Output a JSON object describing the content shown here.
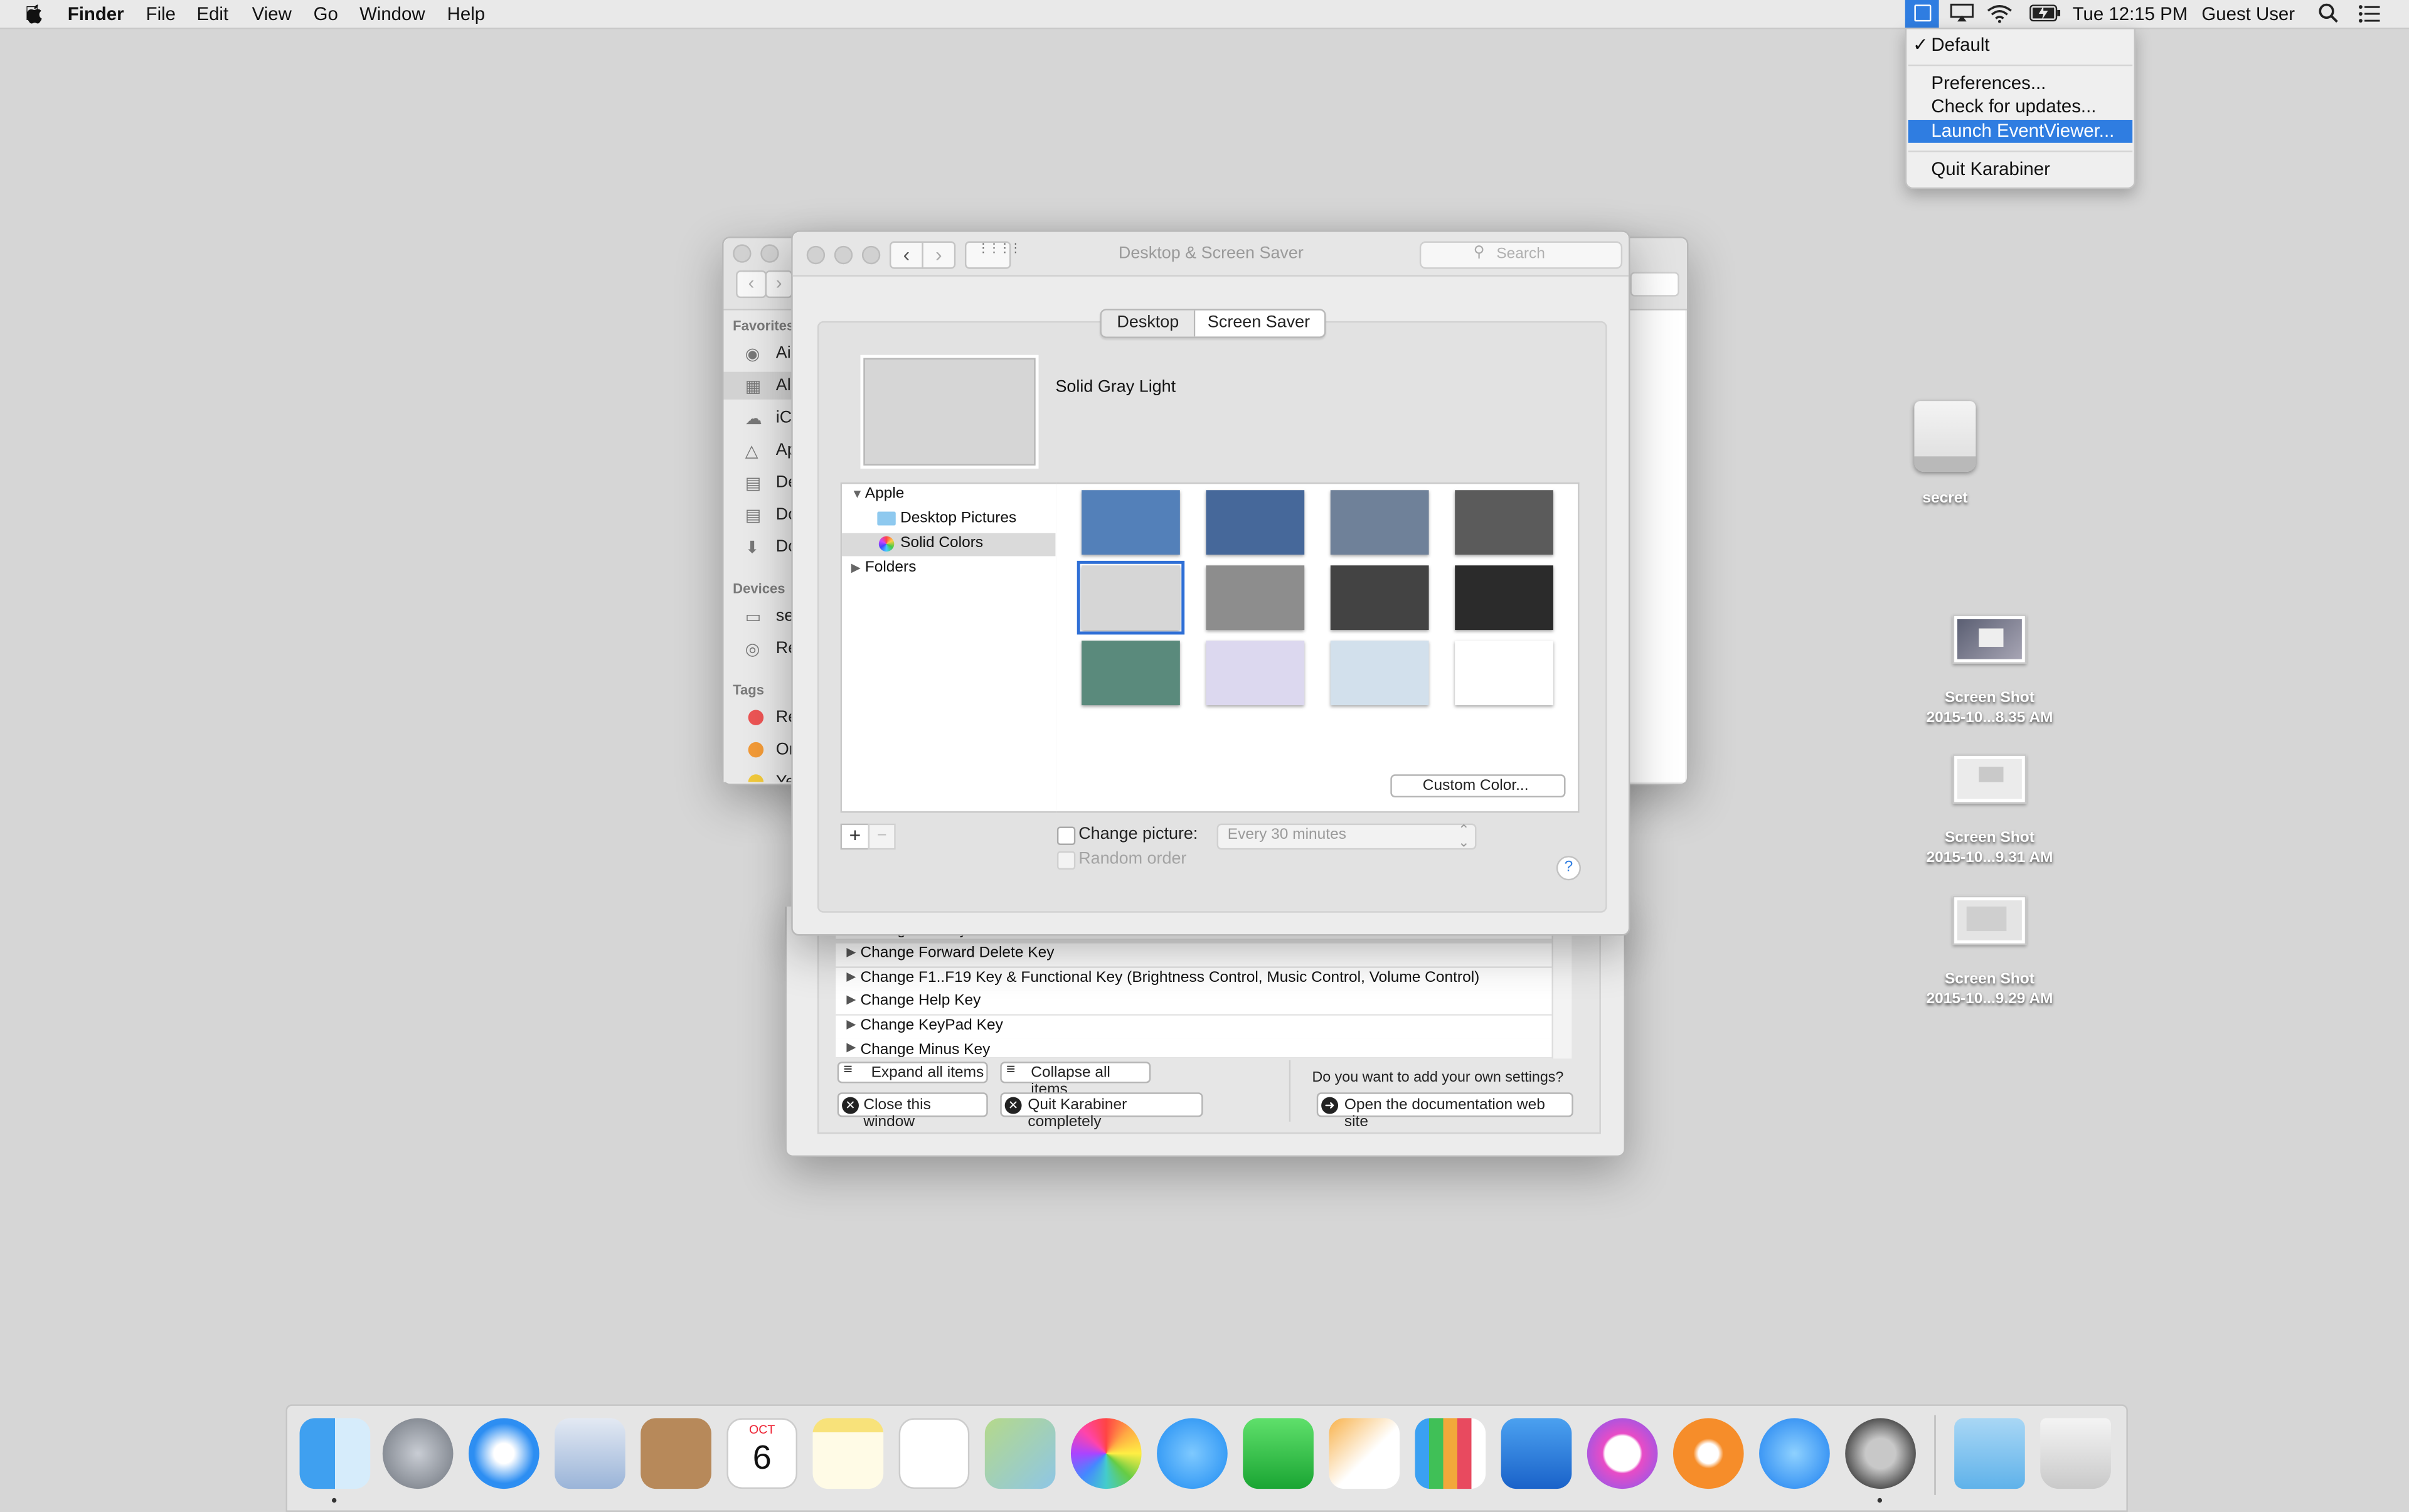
{
  "menubar": {
    "apple": "",
    "app": "Finder",
    "items": [
      "File",
      "Edit",
      "View",
      "Go",
      "Window",
      "Help"
    ],
    "clock": "Tue 12:15 PM",
    "user": "Guest User"
  },
  "karabiner_menu": {
    "checked": "✓",
    "default": "Default",
    "preferences": "Preferences...",
    "check_updates": "Check for updates...",
    "launch_eventviewer": "Launch EventViewer...",
    "quit": "Quit Karabiner",
    "highlight": "#2f7de1"
  },
  "finder": {
    "favorites_header": "Favorites",
    "favorites": [
      "Ai",
      "Al",
      "iC",
      "Ap",
      "De",
      "Do",
      "Do"
    ],
    "devices_header": "Devices",
    "devices": [
      "se",
      "Re"
    ],
    "tags_header": "Tags",
    "tags": [
      {
        "label": "Re",
        "color": "#ec5454"
      },
      {
        "label": "Or",
        "color": "#f29a37"
      },
      {
        "label": "Ye",
        "color": "#f1c93b"
      }
    ]
  },
  "screensaver": {
    "title": "Desktop & Screen Saver",
    "search_placeholder": "Search",
    "tabs": [
      "Desktop",
      "Screen Saver"
    ],
    "preview_label": "Solid Gray Light",
    "tree": {
      "apple": "Apple",
      "desktop_pictures": "Desktop Pictures",
      "solid_colors": "Solid Colors",
      "folders": "Folders"
    },
    "swatches": [
      "#5380b9",
      "#46689a",
      "#6f8199",
      "#5b5b5b",
      "#d6d6d6",
      "#8d8d8d",
      "#434343",
      "#2b2b2b",
      "#5a8a7c",
      "#dcd8ef",
      "#d2e0ec",
      "#ffffff"
    ],
    "selected_swatch": 4,
    "custom_color": "Custom Color...",
    "add": "+",
    "remove": "−",
    "change_picture": "Change picture:",
    "interval": "Every 30 minutes",
    "random_order": "Random order",
    "help": "?"
  },
  "karabiner_window": {
    "rows": [
      "Change F1 Key",
      "Change Forward Delete Key",
      "Change F1..F19 Key & Functional Key (Brightness Control, Music Control, Volume Control)",
      "Change Help Key",
      "Change KeyPad Key",
      "Change Minus Key"
    ],
    "expand": "Expand all items",
    "collapse": "Collapse all items",
    "close": "Close this window",
    "quit": "Quit Karabiner completely",
    "question": "Do you want to add your own settings?",
    "docs": "Open the documentation web site"
  },
  "desktop_icons": [
    {
      "label": "secret"
    },
    {
      "label1": "Screen Shot",
      "label2": "2015-10...8.35 AM"
    },
    {
      "label1": "Screen Shot",
      "label2": "2015-10...9.31 AM"
    },
    {
      "label1": "Screen Shot",
      "label2": "2015-10...9.29 AM"
    }
  ],
  "dock": {
    "calendar_month": "OCT",
    "calendar_day": "6",
    "icons": [
      "finder-icon",
      "launchpad-icon",
      "safari-icon",
      "mail-icon",
      "contacts-icon",
      "calendar-icon",
      "notes-icon",
      "reminders-icon",
      "maps-icon",
      "photos-icon",
      "messages-icon",
      "facetime-icon",
      "pages-icon",
      "numbers-icon",
      "keynote-icon",
      "itunes-icon",
      "ibooks-icon",
      "appstore-icon",
      "system-preferences-icon",
      "downloads-icon",
      "trash-icon"
    ]
  }
}
